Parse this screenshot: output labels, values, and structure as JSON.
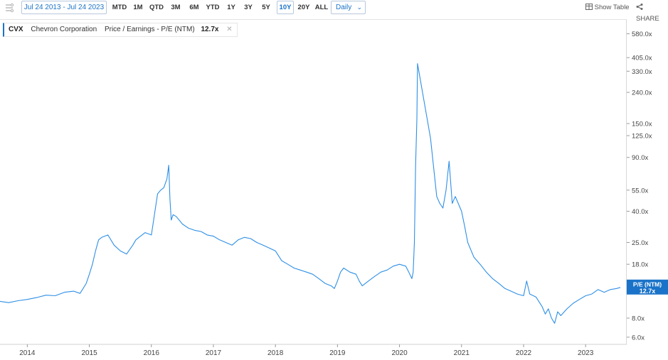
{
  "toolbar": {
    "date_range": "Jul 24 2013 - Jul 24 2023",
    "ranges": [
      "MTD",
      "1M",
      "QTD",
      "3M",
      "6M",
      "YTD",
      "1Y",
      "3Y",
      "5Y",
      "10Y",
      "20Y",
      "ALL"
    ],
    "active_range": "10Y",
    "frequency": "Daily",
    "show_table": "Show Table",
    "share": "SHARE"
  },
  "legend": {
    "ticker": "CVX",
    "company": "Chevron Corporation",
    "metric": "Price / Earnings - P/E (NTM)",
    "value": "12.7x"
  },
  "colors": {
    "series": "#2e8fe6",
    "accent": "#1a73c8"
  },
  "chart_data": {
    "type": "line",
    "yscale": "log",
    "ylim": [
      5.5,
      700
    ],
    "xlim": [
      2013.56,
      2023.56
    ],
    "y_ticks": [
      "580.0x",
      "405.0x",
      "330.0x",
      "240.0x",
      "150.0x",
      "125.0x",
      "90.0x",
      "55.0x",
      "40.0x",
      "25.0x",
      "18.0x",
      "8.0x",
      "6.0x"
    ],
    "x_ticks": [
      "2014",
      "2015",
      "2016",
      "2017",
      "2018",
      "2019",
      "2020",
      "2021",
      "2022",
      "2023"
    ],
    "current_label": {
      "name": "P/E (NTM)",
      "value": "12.7x"
    },
    "series": [
      {
        "x": [
          2013.56,
          2013.7,
          2013.85,
          2014.0,
          2014.15,
          2014.3,
          2014.45,
          2014.6,
          2014.75,
          2014.85,
          2014.9,
          2014.95,
          2015.0,
          2015.05,
          2015.1,
          2015.15,
          2015.2,
          2015.3,
          2015.4,
          2015.5,
          2015.6,
          2015.7,
          2015.75,
          2015.8,
          2015.9,
          2016.0,
          2016.05,
          2016.1,
          2016.15,
          2016.2,
          2016.25,
          2016.28,
          2016.3,
          2016.32,
          2016.35,
          2016.4,
          2016.5,
          2016.6,
          2016.7,
          2016.8,
          2016.9,
          2017.0,
          2017.1,
          2017.2,
          2017.3,
          2017.4,
          2017.5,
          2017.6,
          2017.7,
          2017.8,
          2017.9,
          2018.0,
          2018.1,
          2018.2,
          2018.3,
          2018.4,
          2018.5,
          2018.6,
          2018.7,
          2018.8,
          2018.9,
          2018.95,
          2019.0,
          2019.05,
          2019.1,
          2019.2,
          2019.3,
          2019.35,
          2019.4,
          2019.5,
          2019.6,
          2019.7,
          2019.8,
          2019.9,
          2020.0,
          2020.1,
          2020.15,
          2020.2,
          2020.22,
          2020.24,
          2020.26,
          2020.28,
          2020.29,
          2020.5,
          2020.6,
          2020.65,
          2020.7,
          2020.75,
          2020.8,
          2020.85,
          2020.9,
          2021.0,
          2021.05,
          2021.1,
          2021.2,
          2021.3,
          2021.4,
          2021.5,
          2021.6,
          2021.7,
          2021.8,
          2021.9,
          2022.0,
          2022.05,
          2022.1,
          2022.2,
          2022.3,
          2022.35,
          2022.4,
          2022.45,
          2022.5,
          2022.55,
          2022.6,
          2022.7,
          2022.8,
          2022.9,
          2023.0,
          2023.1,
          2023.2,
          2023.3,
          2023.4,
          2023.5,
          2023.56
        ],
        "y": [
          10.3,
          10.1,
          10.4,
          10.6,
          10.9,
          11.3,
          11.2,
          11.8,
          12.0,
          11.6,
          12.5,
          13.5,
          15.5,
          18.0,
          22.0,
          26.0,
          27.0,
          28.0,
          24.0,
          22.0,
          21.0,
          24.0,
          26.0,
          27.0,
          29.0,
          28.0,
          38.0,
          52.0,
          55.0,
          57.0,
          65.0,
          80.0,
          48.0,
          35.0,
          38.0,
          37.0,
          33.0,
          31.0,
          30.0,
          29.5,
          28.0,
          27.5,
          26.0,
          25.0,
          24.0,
          26.0,
          27.0,
          26.5,
          25.0,
          24.0,
          23.0,
          22.0,
          19.0,
          18.0,
          17.0,
          16.5,
          16.0,
          15.5,
          14.5,
          13.5,
          13.0,
          12.5,
          14.0,
          16.0,
          17.0,
          16.0,
          15.5,
          14.0,
          13.0,
          14.0,
          15.0,
          16.0,
          16.5,
          17.5,
          18.0,
          17.5,
          16.0,
          14.5,
          16.0,
          25.0,
          80.0,
          160.0,
          370.0,
          120.0,
          50.0,
          45.0,
          42.0,
          55.0,
          85.0,
          45.0,
          50.0,
          40.0,
          32.0,
          25.0,
          20.0,
          18.0,
          16.0,
          14.5,
          13.5,
          12.5,
          12.0,
          11.5,
          11.2,
          14.0,
          11.5,
          11.0,
          9.5,
          8.5,
          9.2,
          8.0,
          7.4,
          8.8,
          8.3,
          9.2,
          10.0,
          10.6,
          11.2,
          11.5,
          12.3,
          11.8,
          12.3,
          12.5,
          12.7
        ]
      }
    ]
  }
}
